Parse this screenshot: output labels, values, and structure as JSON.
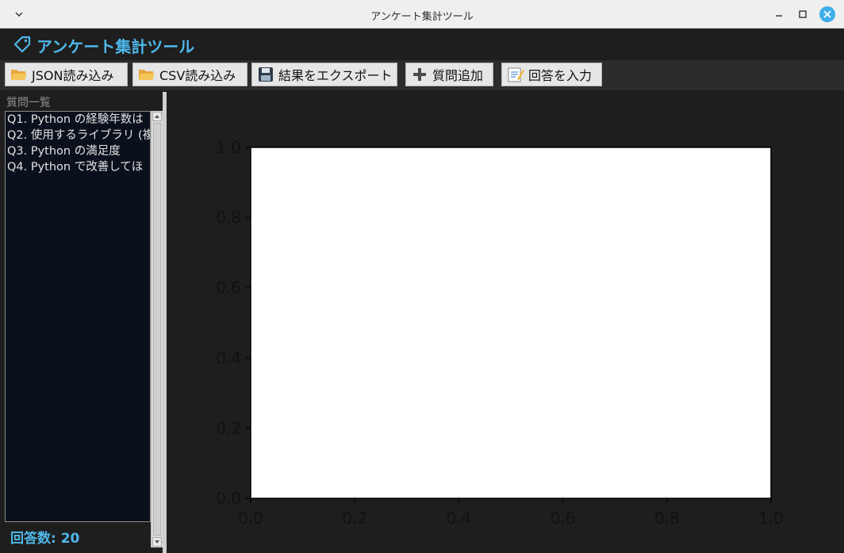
{
  "window": {
    "title": "アンケート集計ツール"
  },
  "header": {
    "title": "アンケート集計ツール",
    "icon": "tag-icon",
    "accent_color": "#4fb8ea"
  },
  "toolbar": {
    "buttons": [
      {
        "icon": "folder-open-icon",
        "label": "JSON読み込み"
      },
      {
        "icon": "folder-open-icon",
        "label": "CSV読み込み"
      },
      {
        "icon": "floppy-disk-icon",
        "label": "結果をエクスポート"
      },
      {
        "icon": "plus-icon",
        "label": "質問追加"
      },
      {
        "icon": "memo-icon",
        "label": "回答を入力"
      }
    ]
  },
  "questions": {
    "label": "質問一覧",
    "items": [
      "Q1. Python の経験年数は",
      "Q2. 使用するライブラリ (複",
      "Q3. Python の満足度",
      "Q4. Python で改善してほ"
    ]
  },
  "responses": {
    "count_label": "回答数: 20"
  },
  "chart_data": {
    "type": "scatter",
    "title": "",
    "xlabel": "",
    "ylabel": "",
    "xlim": [
      0.0,
      1.0
    ],
    "ylim": [
      0.0,
      1.0
    ],
    "xticks": [
      "0.0",
      "0.2",
      "0.4",
      "0.6",
      "0.8",
      "1.0"
    ],
    "yticks": [
      "0.0",
      "0.2",
      "0.4",
      "0.6",
      "0.8",
      "1.0"
    ],
    "series": [],
    "grid": false
  }
}
